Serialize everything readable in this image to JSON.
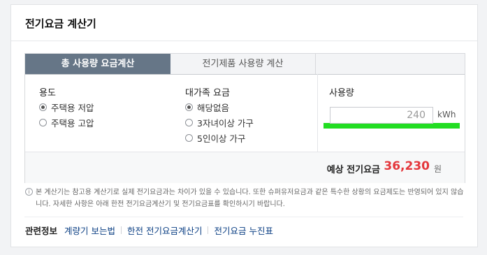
{
  "card": {
    "title": "전기요금 계산기"
  },
  "tabs": [
    {
      "label": "총 사용량 요금계산",
      "active": true
    },
    {
      "label": "전기제품 사용량 계산",
      "active": false
    }
  ],
  "usage_type": {
    "heading": "용도",
    "options": [
      {
        "label": "주택용 저압",
        "checked": true
      },
      {
        "label": "주택용 고압",
        "checked": false
      }
    ]
  },
  "family_rate": {
    "heading": "대가족 요금",
    "options": [
      {
        "label": "해당없음",
        "checked": true
      },
      {
        "label": "3자녀이상 가구",
        "checked": false
      },
      {
        "label": "5인이상 가구",
        "checked": false
      }
    ]
  },
  "usage": {
    "heading": "사용량",
    "value": "240",
    "unit": "kWh"
  },
  "result": {
    "label": "예상 전기요금",
    "value": "36,230",
    "unit": "원"
  },
  "notice": {
    "icon": "info-icon",
    "text": "본 계산기는 참고용 계산기로 실제 전기요금과는 차이가 있을 수 있습니다. 또한 슈퍼유저요금과 같은 특수한 상황의 요금제도는 반영되어 있지 않습니다. 자세한 사항은 아래 한전 전기요금계산기 및 전기요금표를 확인하시기 바랍니다."
  },
  "related": {
    "title": "관련정보",
    "links": [
      "계량기 보는법",
      "한전 전기요금계산기",
      "전기요금 누진표"
    ]
  },
  "colors": {
    "accent_tab": "#667687",
    "result_value": "#e4373c",
    "highlight": "#22dd22",
    "link": "#0a3e83"
  }
}
